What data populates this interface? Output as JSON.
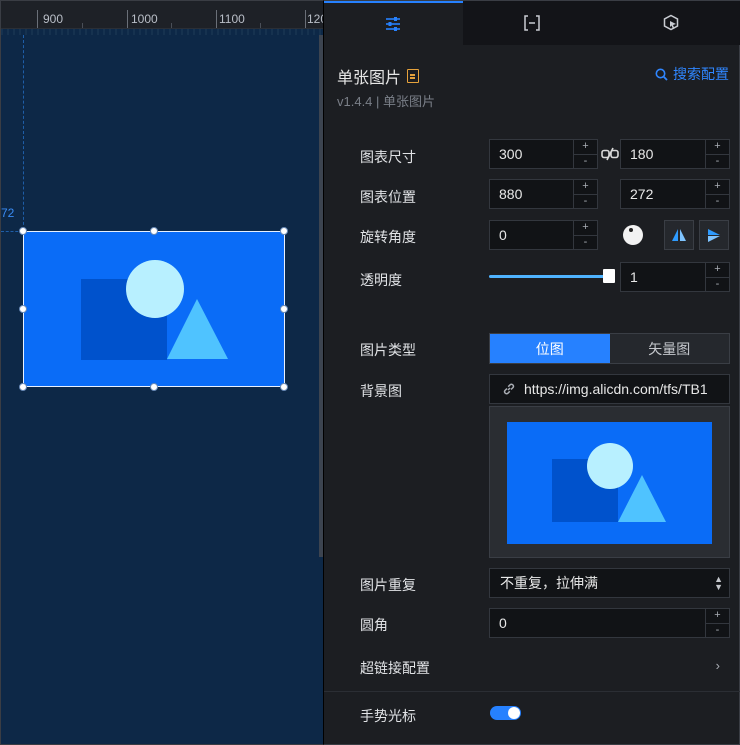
{
  "ruler": {
    "labels": [
      "900",
      "1000",
      "1100",
      "120"
    ]
  },
  "canvas": {
    "guide_label": "72"
  },
  "tabs": [
    {
      "name": "style",
      "icon": "sliders-icon",
      "active": true
    },
    {
      "name": "data",
      "icon": "bracket-data-icon",
      "active": false
    },
    {
      "name": "interaction",
      "icon": "cursor-hexagon-icon",
      "active": false
    }
  ],
  "header": {
    "title": "单张图片",
    "subtitle": "v1.4.4 | 单张图片",
    "search_label": "搜索配置"
  },
  "props": {
    "size": {
      "label": "图表尺寸",
      "width": "300",
      "height": "180"
    },
    "position": {
      "label": "图表位置",
      "x": "880",
      "y": "272"
    },
    "rotation": {
      "label": "旋转角度",
      "value": "0"
    },
    "opacity": {
      "label": "透明度",
      "value": "1",
      "level": 1
    },
    "image_type": {
      "label": "图片类型",
      "options": [
        "位图",
        "矢量图"
      ],
      "selected": "位图"
    },
    "background": {
      "label": "背景图",
      "url": "https://img.alicdn.com/tfs/TB1"
    },
    "repeat": {
      "label": "图片重复",
      "value": "不重复，拉伸满"
    },
    "radius": {
      "label": "圆角",
      "value": "0"
    },
    "hyperlink": {
      "label": "超链接配置"
    },
    "cursor": {
      "label": "手势光标",
      "enabled": true
    }
  },
  "colors": {
    "accent": "#2681ff",
    "canvas_bg": "#0d2847",
    "image_blue": "#0a6cf7",
    "image_dark": "#0052cc",
    "image_light": "#b8f0ff",
    "image_cyan": "#4fc3ff"
  },
  "spinner": {
    "plus": "+",
    "minus": "-"
  }
}
